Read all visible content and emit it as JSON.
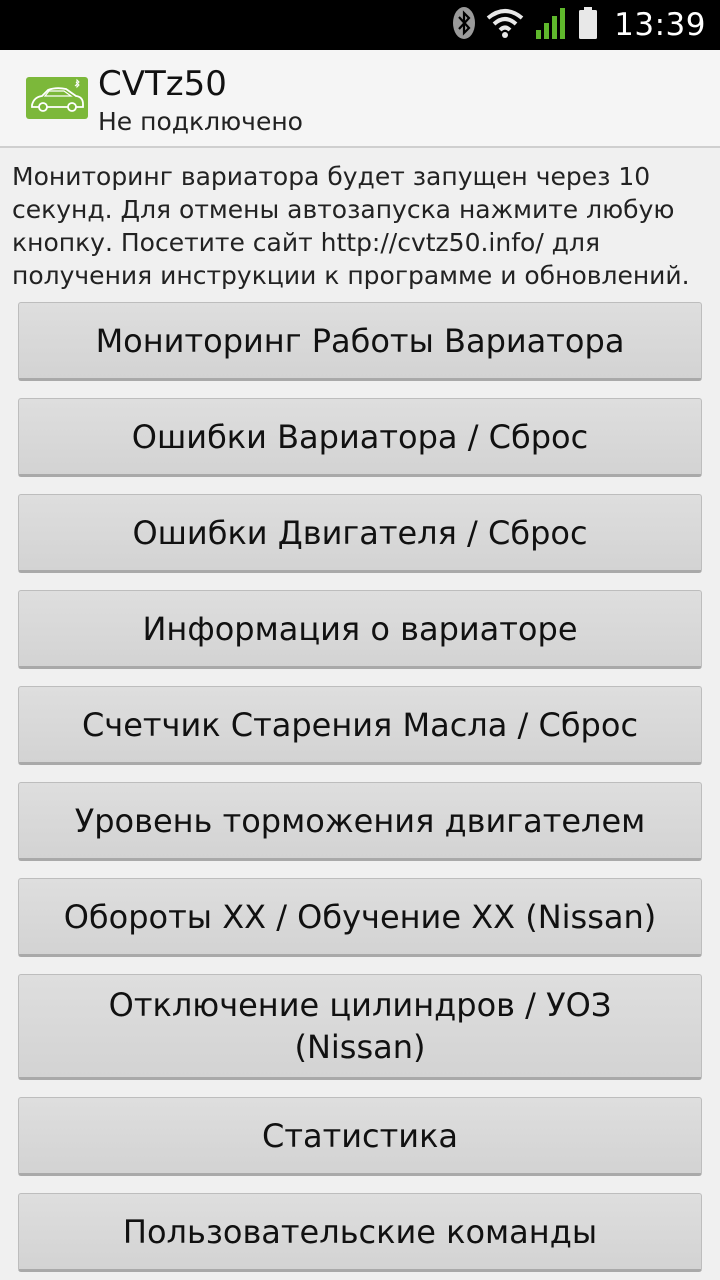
{
  "status_bar": {
    "time": "13:39",
    "icons": [
      "bluetooth-icon",
      "wifi-icon",
      "signal-icon",
      "battery-icon"
    ]
  },
  "app": {
    "title": "CVTz50",
    "subtitle": "Не подключено",
    "icon": "car-icon",
    "accent": "#7cb83a"
  },
  "info_text": "Мониторинг вариатора будет запущен через 10 секунд. Для отмены автозапуска нажмите любую кнопку. Посетите сайт http://cvtz50.info/ для получения инструкции к программе и обновлений.",
  "buttons": [
    "Мониторинг Работы Вариатора",
    "Ошибки Вариатора / Сброс",
    "Ошибки Двигателя / Сброс",
    "Информация о вариаторе",
    "Счетчик Старения Масла / Сброс",
    "Уровень торможения двигателем",
    "Обороты XX / Обучение XX (Nissan)",
    "Отключение цилиндров / УОЗ (Nissan)",
    "Статистика",
    "Пользовательские команды"
  ]
}
